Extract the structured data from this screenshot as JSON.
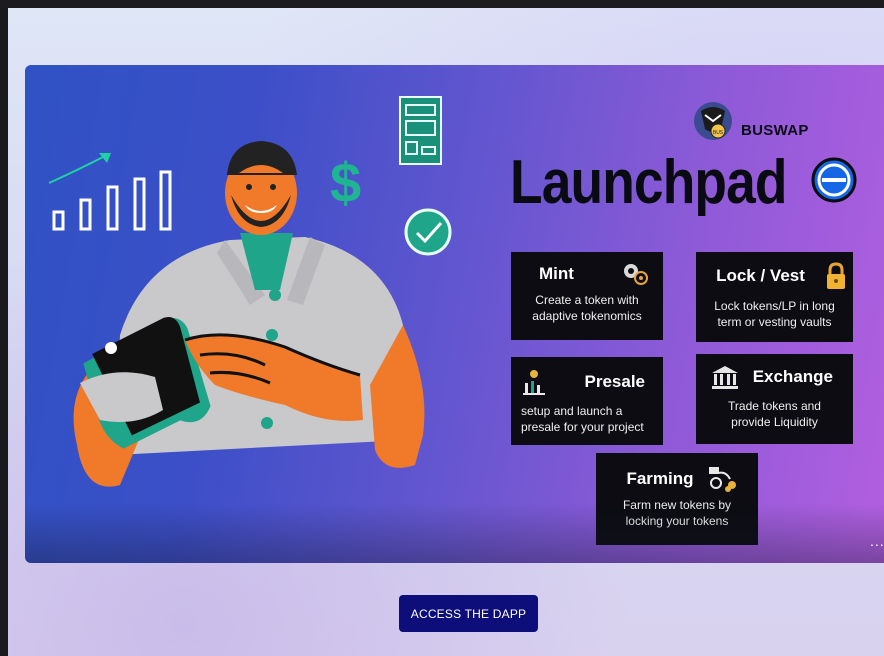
{
  "brand": {
    "name": "BUSWAP"
  },
  "banner": {
    "title": "Launchpad"
  },
  "cards": {
    "mint": {
      "title": "Mint",
      "desc": "Create a  token with adaptive tokenomics",
      "icon": "gears-icon"
    },
    "lock": {
      "title": "Lock / Vest",
      "desc": "Lock tokens/LP in long term or vesting vaults",
      "icon": "padlock-icon"
    },
    "presale": {
      "title": "Presale",
      "desc": "setup and launch a presale for your project",
      "icon": "chart-coin-icon"
    },
    "exchange": {
      "title": "Exchange",
      "desc": "Trade tokens and provide Liquidity",
      "icon": "bank-icon"
    },
    "farming": {
      "title": "Farming",
      "desc": "Farm new tokens by locking your tokens",
      "icon": "farming-icon"
    }
  },
  "carousel": {
    "more": "..."
  },
  "cta": {
    "label": "ACCESS THE DAPP"
  },
  "colors": {
    "button": "#0e0e7a",
    "card": "#0c0c12",
    "banner_left": "#2f52c4",
    "banner_right": "#b25fe0",
    "accent_teal": "#1fa58a",
    "skin": "#f07a2a"
  }
}
